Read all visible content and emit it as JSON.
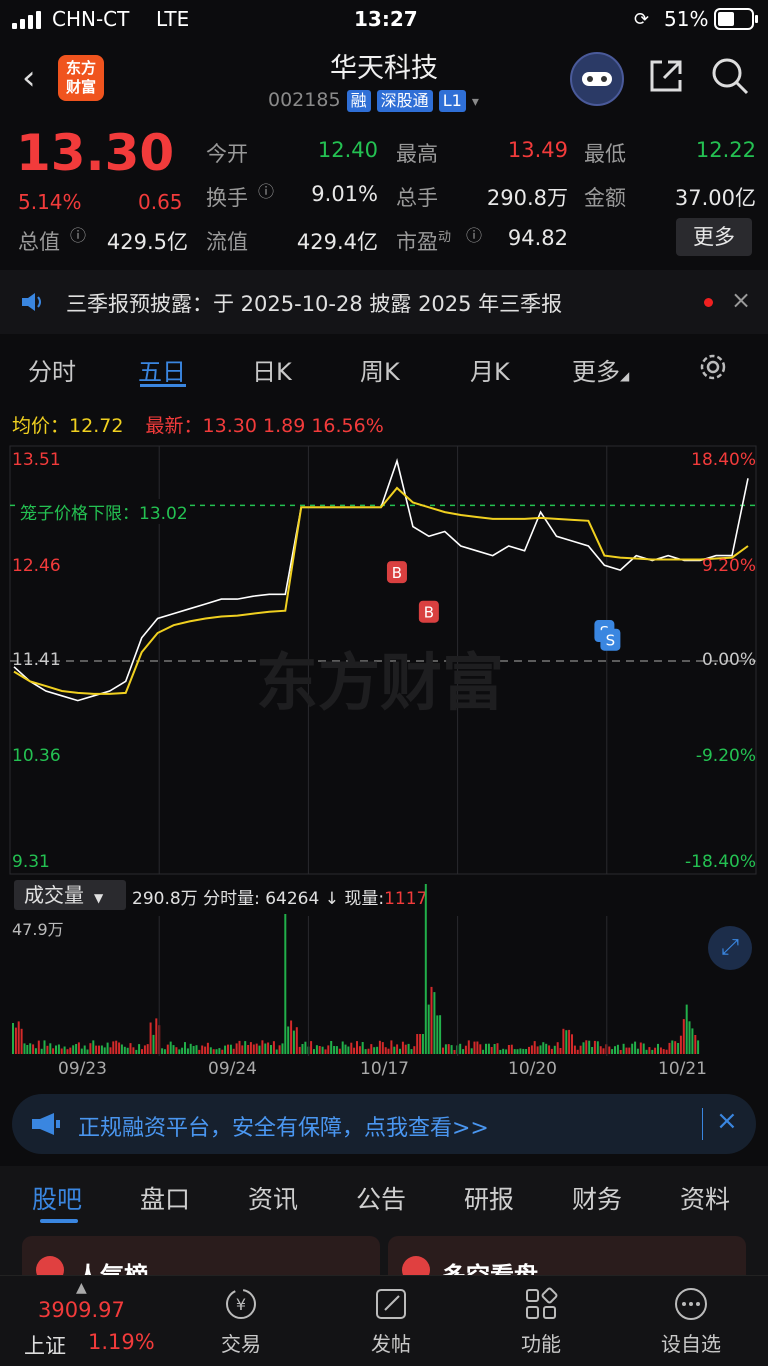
{
  "status_bar": {
    "carrier": "CHN-CT",
    "network": "LTE",
    "time": "13:27",
    "battery": "51%"
  },
  "header": {
    "logo_line1": "东方",
    "logo_line2": "财富",
    "stock_name": "华天科技",
    "stock_code": "002185",
    "tags": [
      "融",
      "深股通",
      "L1"
    ]
  },
  "quote": {
    "price": "13.30",
    "change_pct": "5.14%",
    "change_amt": "0.65",
    "open_label": "今开",
    "open": "12.40",
    "high_label": "最高",
    "high": "13.49",
    "low_label": "最低",
    "low": "12.22",
    "turnover_label": "换手",
    "turnover": "9.01%",
    "volume_label": "总手",
    "volume": "290.8万",
    "amount_label": "金额",
    "amount": "37.00亿",
    "mktcap_label": "总值",
    "mktcap": "429.5亿",
    "float_label": "流值",
    "float": "429.4亿",
    "pe_label": "市盈",
    "pe_sup": "动",
    "pe": "94.82",
    "more_button": "更多"
  },
  "notice": {
    "text": "三季报预披露：于 2025-10-28 披露 2025 年三季报"
  },
  "chart_tabs": [
    "分时",
    "五日",
    "日K",
    "周K",
    "月K",
    "更多"
  ],
  "chart_info": {
    "avg_label": "均价：",
    "avg": "12.72",
    "latest_label": "最新：",
    "latest": "13.30",
    "latest_chg": "1.89",
    "latest_pct": "16.56%"
  },
  "chart_data": {
    "type": "line",
    "title": "",
    "y_left_ticks": [
      "13.51",
      "12.46",
      "11.41",
      "10.36",
      "9.31"
    ],
    "y_right_ticks": [
      "18.40%",
      "9.20%",
      "0.00%",
      "-9.20%",
      "-18.40%"
    ],
    "ylim": [
      9.31,
      13.51
    ],
    "x_ticks": [
      "09/23",
      "09/24",
      "10/17",
      "10/20",
      "10/21"
    ],
    "limit_line_label": "笼子价格下限：13.02",
    "limit_line": 13.02,
    "prev_close": 11.41,
    "watermark": "东方财富",
    "markers": [
      "B",
      "B",
      "S",
      "S"
    ],
    "series": [
      {
        "name": "",
        "color": "#ffffff",
        "values": [
          11.35,
          11.2,
          11.1,
          11.05,
          11.0,
          11.05,
          11.1,
          11.2,
          11.65,
          11.85,
          11.9,
          11.95,
          12.0,
          12.05,
          12.05,
          12.08,
          12.1,
          12.1,
          13.0,
          13.0,
          13.0,
          13.0,
          13.0,
          13.0,
          13.48,
          12.8,
          12.7,
          12.75,
          12.6,
          12.55,
          12.5,
          12.6,
          12.55,
          12.95,
          12.7,
          12.65,
          12.6,
          12.4,
          12.35,
          12.5,
          12.45,
          12.5,
          12.45,
          12.45,
          12.5,
          12.5,
          13.3
        ]
      },
      {
        "name": "",
        "color": "#f0d020",
        "values": [
          11.3,
          11.2,
          11.15,
          11.1,
          11.08,
          11.07,
          11.07,
          11.08,
          11.5,
          11.7,
          11.78,
          11.82,
          11.85,
          11.87,
          11.88,
          11.9,
          11.92,
          11.93,
          13.0,
          13.0,
          13.0,
          13.0,
          13.0,
          13.0,
          13.2,
          13.05,
          13.0,
          12.95,
          12.92,
          12.9,
          12.88,
          12.88,
          12.88,
          12.89,
          12.88,
          12.87,
          12.86,
          12.5,
          12.48,
          12.47,
          12.46,
          12.46,
          12.46,
          12.46,
          12.47,
          12.48,
          12.6
        ]
      }
    ]
  },
  "volume_panel": {
    "dropdown_label": "成交量",
    "total": "290.8万",
    "minute_vol_label": "分时量:",
    "minute_vol": "64264",
    "arrow": "↓",
    "current_label": "现量:",
    "current": "1117",
    "max_label": "47.9万"
  },
  "banner": {
    "text": "正规融资平台，安全有保障，点我查看>>"
  },
  "bottom_tabs": [
    "股吧",
    "盘口",
    "资讯",
    "公告",
    "研报",
    "财务",
    "资料"
  ],
  "cards": [
    "人气榜",
    "多空看盘"
  ],
  "bottom_nav": {
    "index_value": "3909.97",
    "index_name": "上证",
    "index_pct": "1.19%",
    "items": [
      "交易",
      "发帖",
      "功能",
      "设自选"
    ]
  }
}
